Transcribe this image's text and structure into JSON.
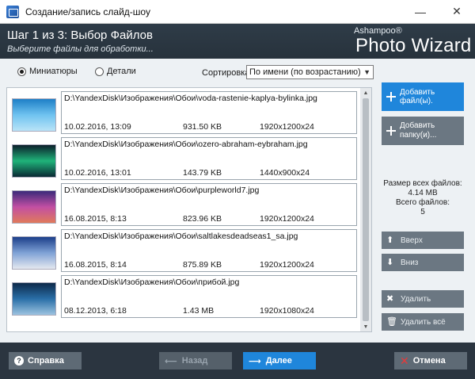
{
  "window": {
    "title": "Создание/запись слайд-шоу",
    "minimize": "—",
    "close": "✕"
  },
  "header": {
    "step": "Шаг 1 из 3: Выбор Файлов",
    "subtitle": "Выберите файлы для обработки...",
    "brand_top": "Ashampoo®",
    "brand_main": "Photo Wizard"
  },
  "view": {
    "thumbnails_label": "Миниатюры",
    "details_label": "Детали",
    "selected": "thumbnails"
  },
  "sort": {
    "label": "Сортировка:",
    "value": "По имени (по возрастанию)"
  },
  "files": [
    {
      "path": "D:\\YandexDisk\\Изображения\\Обои\\voda-rastenie-kaplya-bylinka.jpg",
      "date": "10.02.2016, 13:09",
      "size": "931.50 KB",
      "dims": "1920x1200x24",
      "thumb_colors": [
        "#1e7fc7",
        "#6fc3f0",
        "#b9e3f7"
      ]
    },
    {
      "path": "D:\\YandexDisk\\Изображения\\Обои\\ozero-abraham-eybraham.jpg",
      "date": "10.02.2016, 13:01",
      "size": "143.79 KB",
      "dims": "1440x900x24",
      "thumb_colors": [
        "#0c1f2b",
        "#1fb37a",
        "#0a2a33"
      ]
    },
    {
      "path": "D:\\YandexDisk\\Изображения\\Обои\\purpleworld7.jpg",
      "date": "16.08.2015, 8:13",
      "size": "823.96 KB",
      "dims": "1920x1200x24",
      "thumb_colors": [
        "#3b2a7a",
        "#c24fa3",
        "#e07a5b"
      ]
    },
    {
      "path": "D:\\YandexDisk\\Изображения\\Обои\\saltlakesdeadseas1_sa.jpg",
      "date": "16.08.2015, 8:14",
      "size": "875.89 KB",
      "dims": "1920x1200x24",
      "thumb_colors": [
        "#1b3f8a",
        "#7fa2d6",
        "#e4e8ef"
      ]
    },
    {
      "path": "D:\\YandexDisk\\Изображения\\Обои\\прибой.jpg",
      "date": "08.12.2013, 6:18",
      "size": "1.43 MB",
      "dims": "1920x1080x24",
      "thumb_colors": [
        "#0d2a4a",
        "#2a6fa8",
        "#9cc3e0"
      ]
    }
  ],
  "actions": {
    "add_files": "Добавить файл(ы).",
    "add_folder_line1": "Добавить",
    "add_folder_line2": "папку(и)...",
    "up": "Вверх",
    "down": "Вниз",
    "remove": "Удалить",
    "remove_all": "Удалить всё"
  },
  "stats": {
    "total_size_label": "Размер всех файлов:",
    "total_size": "4.14 MB",
    "total_count_label": "Всего файлов:",
    "total_count": "5"
  },
  "footer": {
    "help": "Справка",
    "back": "Назад",
    "next": "Далее",
    "cancel": "Отмена"
  },
  "colors": {
    "accent": "#1f86db",
    "header_bg": "#2b3540",
    "panel_bg": "#edf1f4"
  }
}
